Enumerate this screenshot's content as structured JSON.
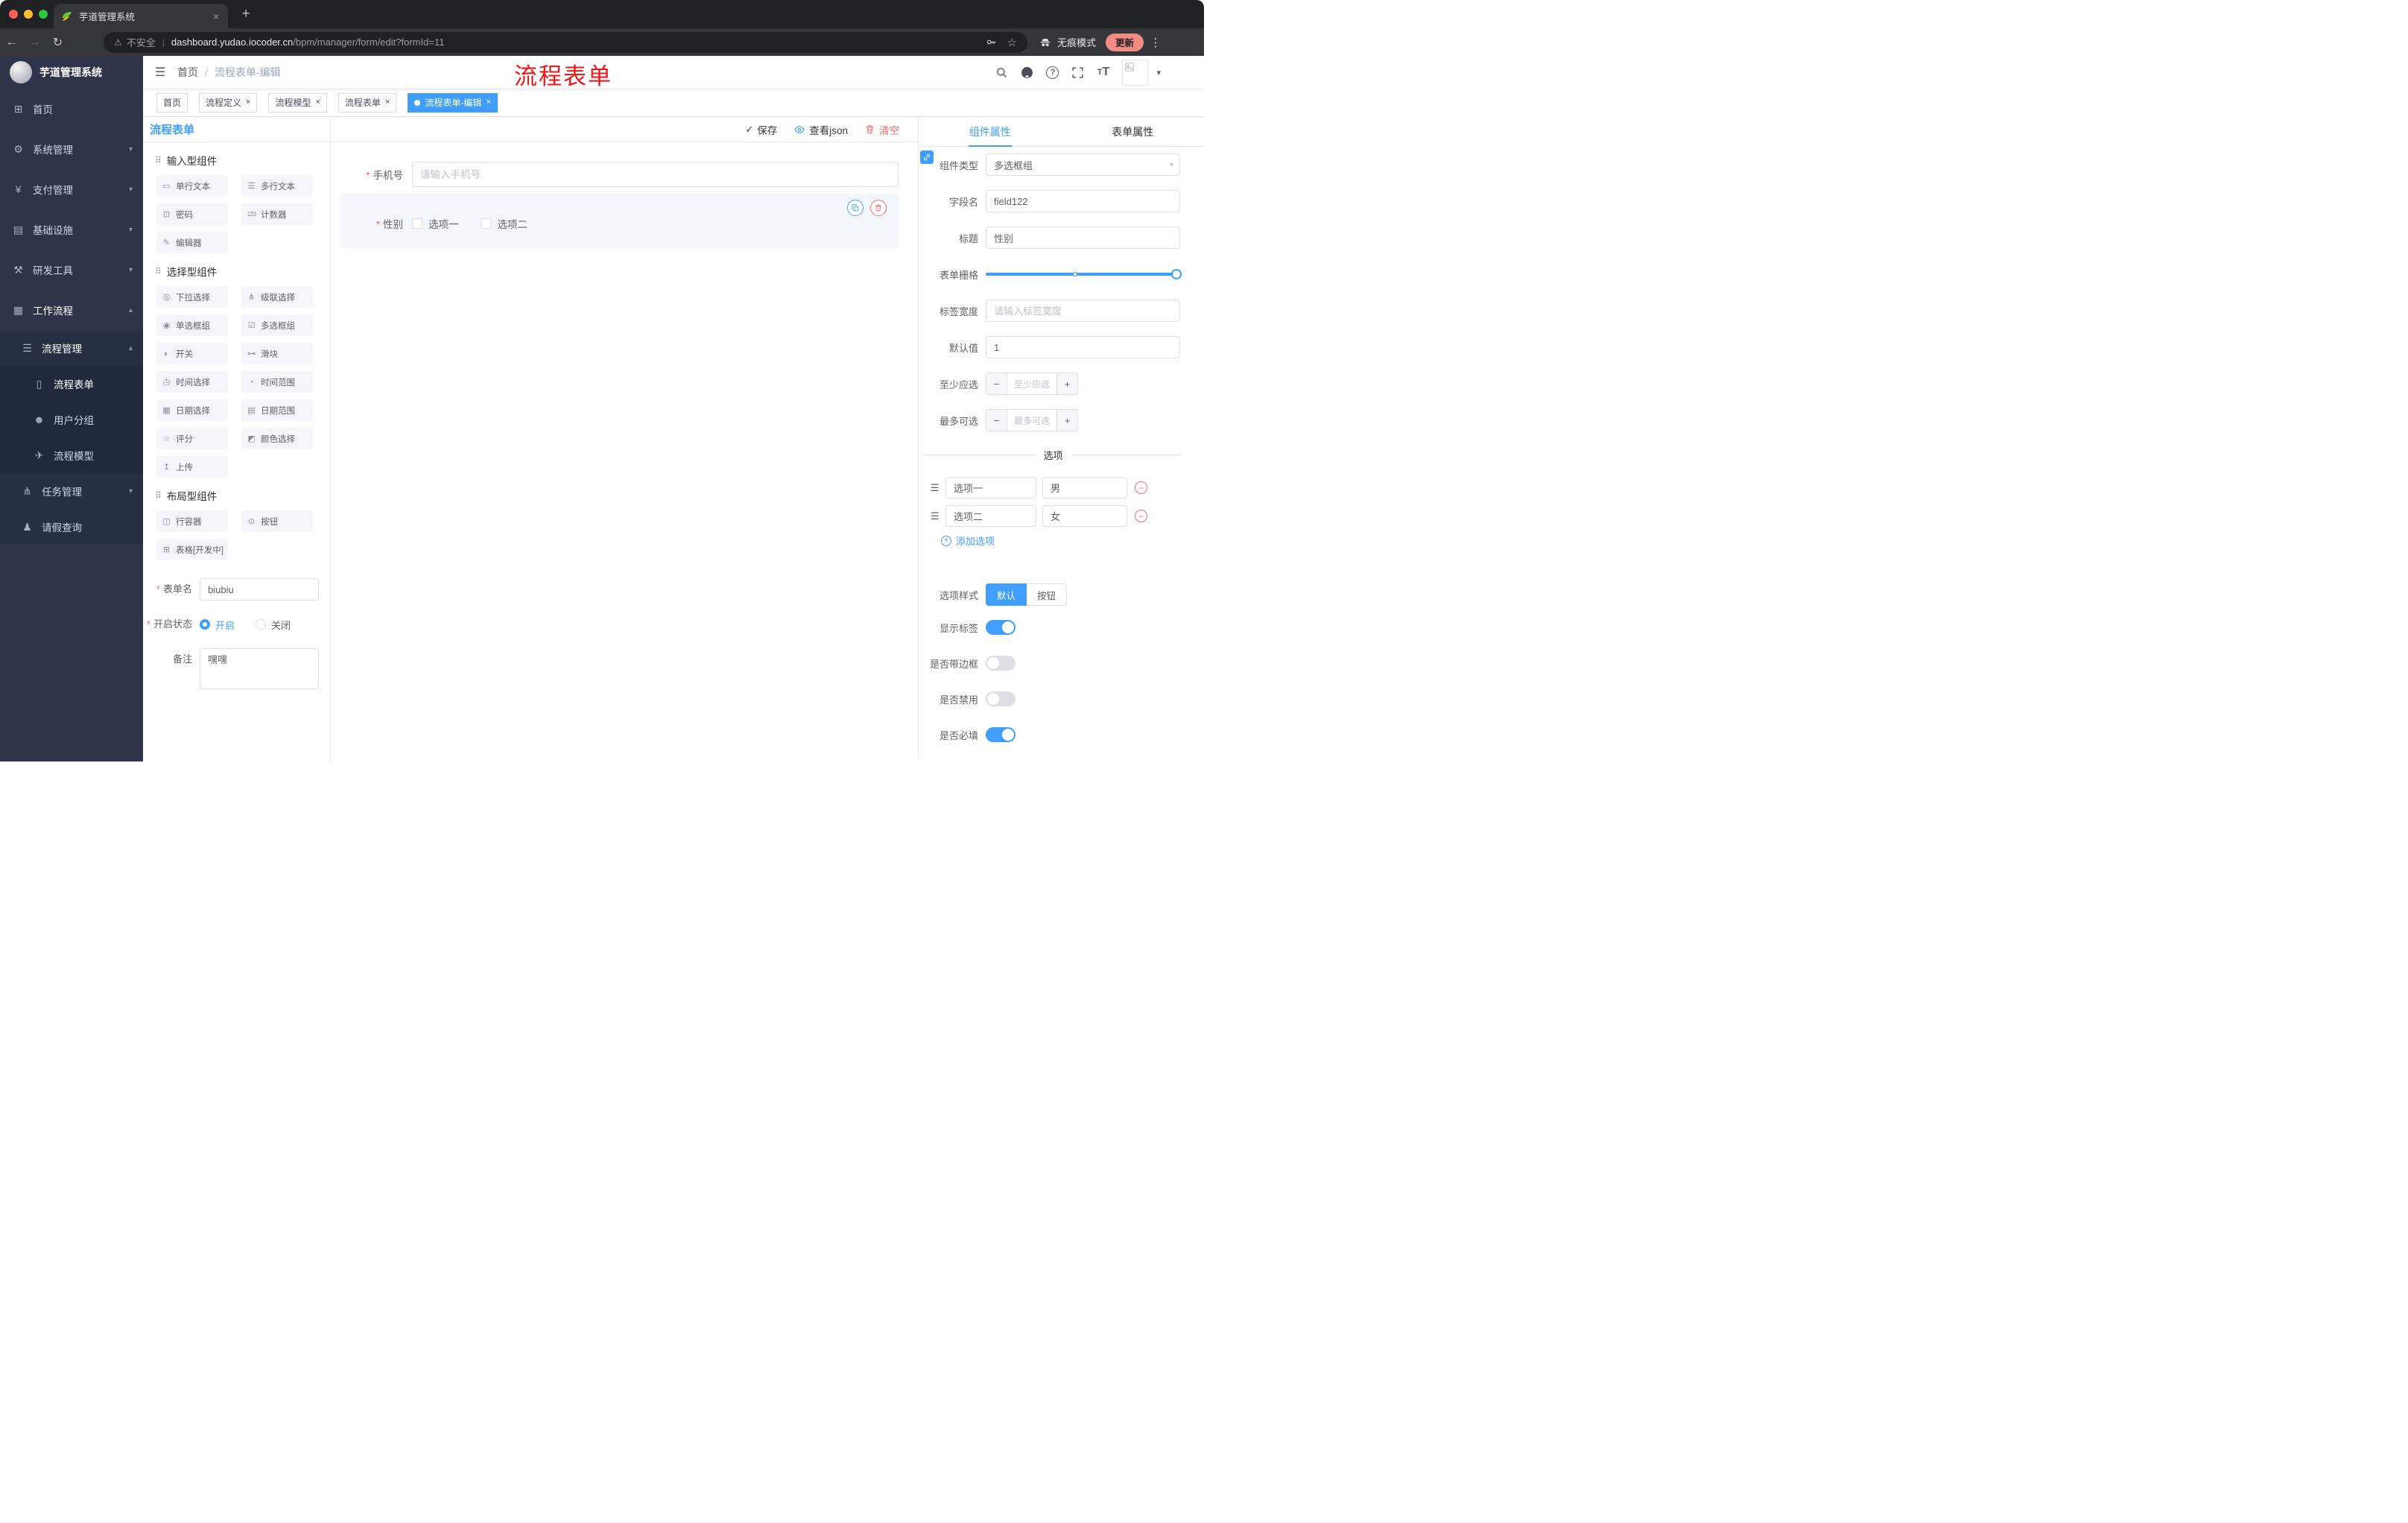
{
  "annotation": "流程表单",
  "glyphs": {
    "back": "←",
    "forward": "→",
    "reload": "↻",
    "plus": "+",
    "close": "×",
    "kebab": "⋮",
    "warn": "⚠",
    "pipe": "|",
    "star": "☆",
    "fold": "☰",
    "caret": "▾",
    "check": "✓",
    "help": "?",
    "minus": "−",
    "dots": "⠿",
    "handle": "☰",
    "tt": "T"
  },
  "browser": {
    "tab_title": "芋道管理系统",
    "security_label": "不安全",
    "url_host": "dashboard.yudao.iocoder.cn",
    "url_path": "/bpm/manager/form/edit?formId=11",
    "incognito_label": "无痕模式",
    "update_label": "更新"
  },
  "sidebar": {
    "logo_title": "芋道管理系统",
    "items": [
      {
        "icon": "⊞",
        "label": "首页"
      },
      {
        "icon": "⚙",
        "label": "系统管理",
        "chevron": "▾"
      },
      {
        "icon": "¥",
        "label": "支付管理",
        "chevron": "▾"
      },
      {
        "icon": "▤",
        "label": "基础设施",
        "chevron": "▾"
      },
      {
        "icon": "⚒",
        "label": "研发工具",
        "chevron": "▾"
      },
      {
        "icon": "▦",
        "label": "工作流程",
        "chevron": "▴"
      },
      {
        "icon": "☰",
        "label": "流程管理",
        "chevron": "▴"
      },
      {
        "icon": "▯",
        "label": "流程表单"
      },
      {
        "icon": "☻",
        "label": "用户分组"
      },
      {
        "icon": "✈",
        "label": "流程模型"
      },
      {
        "icon": "⋔",
        "label": "任务管理",
        "chevron": "▾"
      },
      {
        "icon": "♟",
        "label": "请假查询"
      }
    ]
  },
  "header": {
    "breadcrumb_home": "首页",
    "separator": "/",
    "breadcrumb_current": "流程表单-编辑"
  },
  "tags": [
    {
      "label": "首页"
    },
    {
      "label": "流程定义"
    },
    {
      "label": "流程模型"
    },
    {
      "label": "流程表单"
    },
    {
      "label": "流程表单-编辑"
    }
  ],
  "designer": {
    "panel_title": "流程表单",
    "save_label": "保存",
    "view_json_label": "查看json",
    "clear_label": "清空",
    "sections": [
      {
        "title": "输入型组件",
        "items": [
          {
            "icon": "▭",
            "label": "单行文本"
          },
          {
            "icon": "☰",
            "label": "多行文本"
          },
          {
            "icon": "⊡",
            "label": "密码"
          },
          {
            "icon": "123",
            "label": "计数器"
          },
          {
            "icon": "✎",
            "label": "编辑器"
          }
        ]
      },
      {
        "title": "选择型组件",
        "items": [
          {
            "icon": "◎",
            "label": "下拉选择"
          },
          {
            "icon": "⋔",
            "label": "级联选择"
          },
          {
            "icon": "◉",
            "label": "单选框组"
          },
          {
            "icon": "☑",
            "label": "多选框组"
          },
          {
            "icon": "◐",
            "label": "开关"
          },
          {
            "icon": "⊶",
            "label": "滑块"
          },
          {
            "icon": "◷",
            "label": "时间选择"
          },
          {
            "icon": "◔",
            "label": "时间范围"
          },
          {
            "icon": "▦",
            "label": "日期选择"
          },
          {
            "icon": "▤",
            "label": "日期范围"
          },
          {
            "icon": "☆",
            "label": "评分"
          },
          {
            "icon": "◩",
            "label": "颜色选择"
          },
          {
            "icon": "↥",
            "label": "上传"
          }
        ]
      },
      {
        "title": "布局型组件",
        "items": [
          {
            "icon": "◫",
            "label": "行容器"
          },
          {
            "icon": "⊙",
            "label": "按钮"
          },
          {
            "icon": "⊞",
            "label": "表格[开发中]"
          }
        ]
      }
    ],
    "meta": {
      "name_label": "表单名",
      "name_value": "biubiu",
      "status_label": "开启状态",
      "status_on": "开启",
      "status_off": "关闭",
      "remark_label": "备注",
      "remark_value": "嘿嘿"
    },
    "canvas": {
      "phone_label": "手机号",
      "phone_placeholder": "请输入手机号",
      "gender_label": "性别",
      "gender_opt1": "选项一",
      "gender_opt2": "选项二"
    }
  },
  "props": {
    "tab_component": "组件属性",
    "tab_form": "表单属性",
    "type_label": "组件类型",
    "type_value": "多选框组",
    "field_label": "字段名",
    "field_value": "field122",
    "title_label": "标题",
    "title_value": "性别",
    "grid_label": "表单栅格",
    "width_label": "标签宽度",
    "width_placeholder": "请输入标签宽度",
    "default_label": "默认值",
    "default_value": "1",
    "min_label": "至少应选",
    "min_placeholder": "至少应选",
    "max_label": "最多可选",
    "max_placeholder": "最多可选",
    "options_divider": "选项",
    "option_rows": [
      {
        "label": "选项一",
        "value": "男"
      },
      {
        "label": "选项二",
        "value": "女"
      }
    ],
    "add_option": "添加选项",
    "style_label": "选项样式",
    "style_default": "默认",
    "style_button": "按钮",
    "show_label": "显示标签",
    "border_label": "是否带边框",
    "disabled_label": "是否禁用",
    "required_label": "是否必填"
  },
  "colors": {
    "accent": "#409eff",
    "danger": "#f56c6c",
    "sidebar_bg": "#2e3548",
    "update_chip": "#f28b82"
  }
}
